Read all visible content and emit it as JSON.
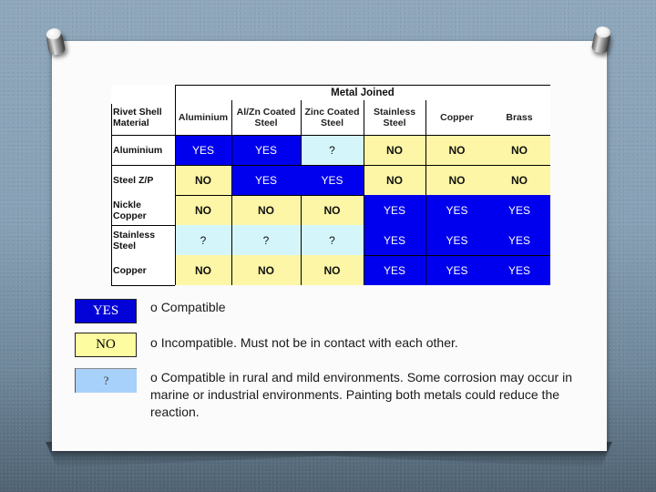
{
  "table": {
    "title": "Metal Joined",
    "corner_header": "Rivet Shell Material",
    "columns": [
      "Aluminium",
      "Al/Zn Coated Steel",
      "Zinc Coated Steel",
      "Stainless Steel",
      "Copper",
      "Brass"
    ],
    "rows": [
      {
        "label": "Aluminium",
        "values": [
          "YES",
          "YES",
          "?",
          "NO",
          "NO",
          "NO"
        ]
      },
      {
        "label": "Steel Z/P",
        "values": [
          "NO",
          "YES",
          "YES",
          "NO",
          "NO",
          "NO"
        ]
      },
      {
        "label": "Nickle Copper",
        "values": [
          "NO",
          "NO",
          "NO",
          "YES",
          "YES",
          "YES"
        ]
      },
      {
        "label": "Stainless Steel",
        "values": [
          "?",
          "?",
          "?",
          "YES",
          "YES",
          "YES"
        ]
      },
      {
        "label": "Copper",
        "values": [
          "NO",
          "NO",
          "NO",
          "YES",
          "YES",
          "YES"
        ]
      }
    ],
    "colors": {
      "YES": "#0000ee",
      "NO": "#fdf6a6",
      "?": "#d4f6fb"
    }
  },
  "legend": [
    {
      "swatch": "YES",
      "bullet": "o",
      "text": "Compatible",
      "color": "#0303d8"
    },
    {
      "swatch": "NO",
      "bullet": "o",
      "text": "Incompatible. Must not be in contact with each other.",
      "color": "#fdfca0"
    },
    {
      "swatch": "?",
      "bullet": "o",
      "text": "Compatible in rural and mild environments. Some corrosion may occur in marine or industrial environments. Painting both metals could reduce the reaction.",
      "color": "#a7d1fb"
    }
  ]
}
